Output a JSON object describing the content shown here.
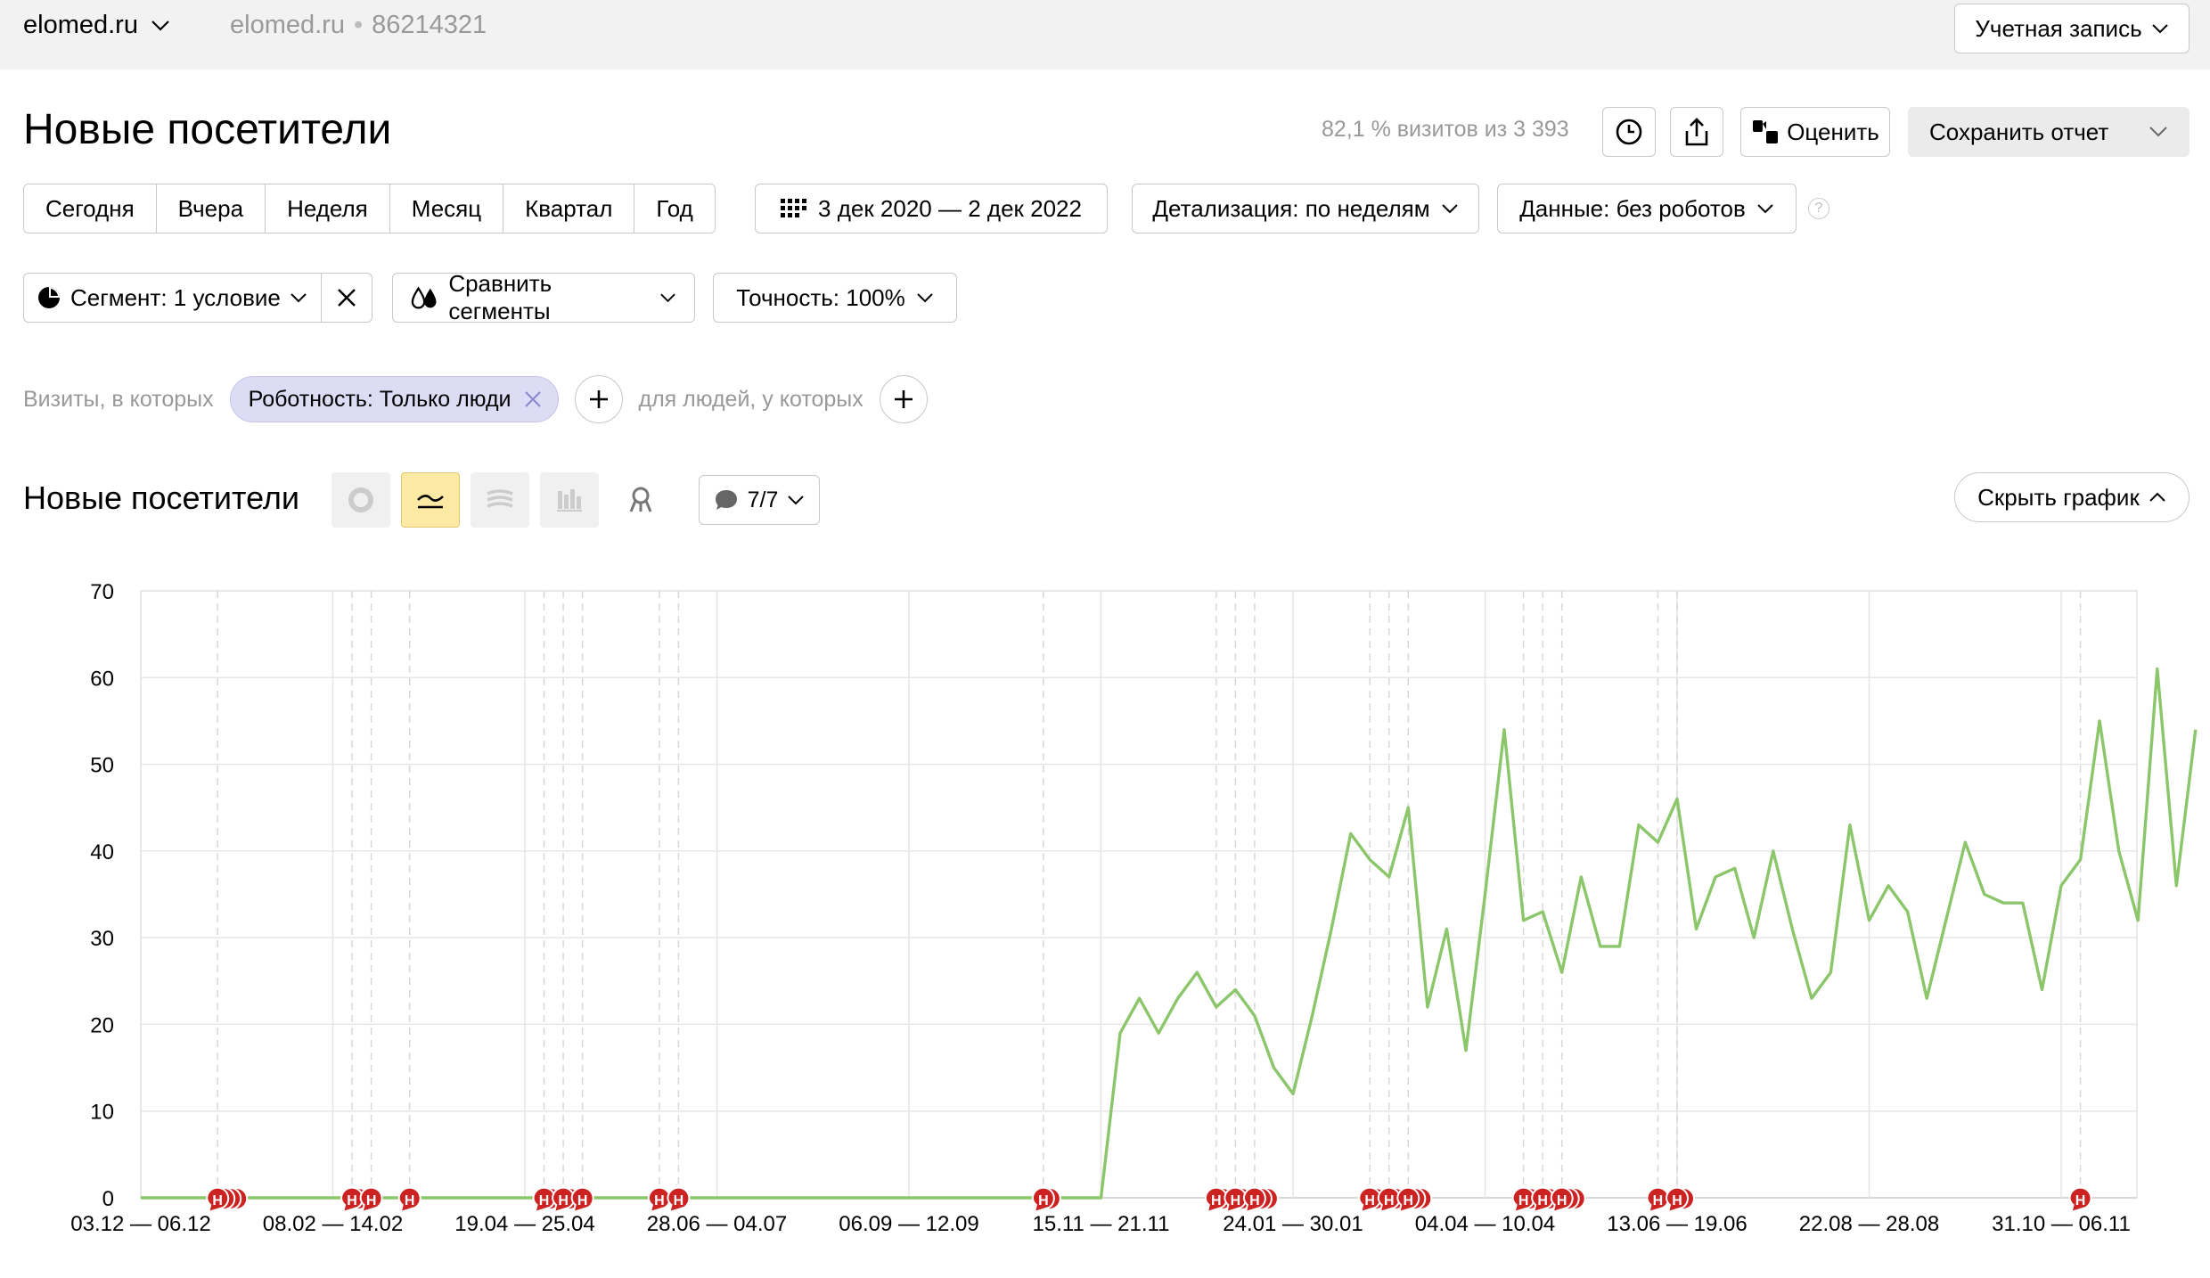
{
  "header": {
    "site": "elomed.ru",
    "site_secondary": "elomed.ru",
    "counter_id": "86214321",
    "account_label": "Учетная запись"
  },
  "report": {
    "title": "Новые посетители",
    "visits_info": "82,1 % визитов из 3 393",
    "rate_label": "Оценить",
    "save_label": "Сохранить отчет"
  },
  "periods": [
    "Сегодня",
    "Вчера",
    "Неделя",
    "Месяц",
    "Квартал",
    "Год"
  ],
  "date_range": "3 дек 2020 — 2 дек 2022",
  "detail_label": "Детализация: по неделям",
  "data_label": "Данные: без роботов",
  "segment": {
    "label": "Сегмент: 1 условие",
    "compare_label": "Сравнить сегменты",
    "accuracy_label": "Точность: 100%"
  },
  "filters": {
    "visits_label": "Визиты, в которых",
    "chip_label": "Роботность: Только люди",
    "people_label": "для людей, у которых"
  },
  "chart_section": {
    "title": "Новые посетители",
    "notes_label": "7/7",
    "hide_label": "Скрыть график",
    "active_type": "line"
  },
  "colors": {
    "line": "#8cc66a",
    "note_marker": "#cc2222",
    "active_chart_btn": "#fce9a4"
  },
  "chart_data": {
    "type": "line",
    "title": "",
    "xlabel": "",
    "ylabel": "",
    "ylim": [
      0,
      70
    ],
    "yticks": [
      0,
      10,
      20,
      30,
      40,
      50,
      60,
      70
    ],
    "x_tick_labels": [
      "03.12 — 06.12",
      "08.02 — 14.02",
      "19.04 — 25.04",
      "28.06 — 04.07",
      "06.09 — 12.09",
      "15.11 — 21.11",
      "24.01 — 30.01",
      "04.04 — 10.04",
      "13.06 — 19.06",
      "22.08 — 28.08",
      "31.10 — 06.11"
    ],
    "x_tick_week_index": [
      0,
      10,
      20,
      30,
      40,
      50,
      60,
      70,
      80,
      90,
      100
    ],
    "series": [
      {
        "values": [
          0,
          0,
          0,
          0,
          0,
          0,
          0,
          0,
          0,
          0,
          0,
          0,
          0,
          0,
          0,
          0,
          0,
          0,
          0,
          0,
          0,
          0,
          0,
          0,
          0,
          0,
          0,
          0,
          0,
          0,
          0,
          0,
          0,
          0,
          0,
          0,
          0,
          0,
          0,
          0,
          0,
          0,
          0,
          0,
          0,
          0,
          0,
          0,
          0,
          0,
          0,
          19,
          23,
          19,
          23,
          26,
          22,
          24,
          21,
          15,
          12,
          21,
          31,
          42,
          39,
          37,
          45,
          22,
          31,
          17,
          35,
          54,
          32,
          33,
          26,
          37,
          29,
          29,
          43,
          41,
          46,
          31,
          37,
          38,
          30,
          40,
          31,
          23,
          26,
          43,
          32,
          36,
          33,
          23,
          32,
          41,
          35,
          34,
          34,
          24,
          36,
          39,
          55,
          40,
          32,
          61,
          36,
          54
        ]
      }
    ],
    "note_markers": {
      "label": "Н",
      "week_index": [
        4,
        11,
        12,
        14,
        21,
        22,
        23,
        27,
        28,
        47,
        56,
        57,
        58,
        64,
        65,
        66,
        72,
        73,
        74,
        79,
        80,
        101
      ],
      "stacked_extra": [
        3,
        1,
        0,
        0,
        2,
        1,
        0,
        0,
        0,
        1,
        1,
        1,
        2,
        1,
        1,
        2,
        1,
        1,
        2,
        0,
        1,
        0
      ]
    }
  }
}
